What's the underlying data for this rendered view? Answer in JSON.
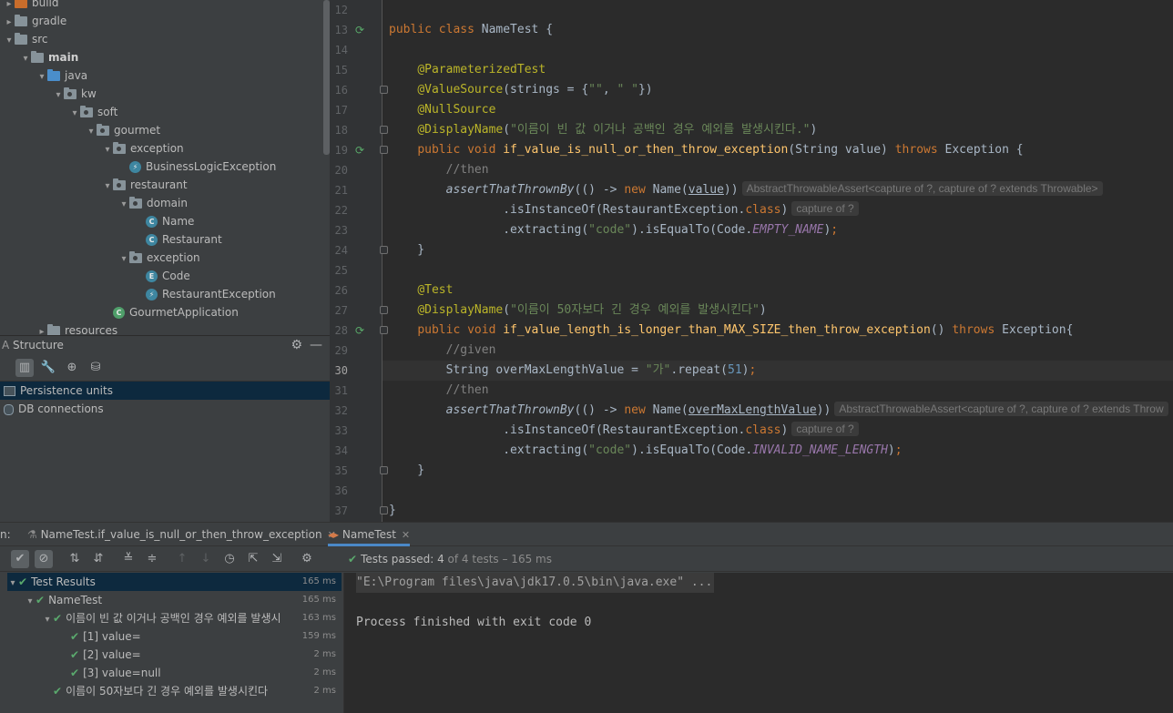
{
  "project_tree": [
    {
      "label": "build",
      "icon": "folder-orange",
      "indent": 0,
      "arrow": "▸"
    },
    {
      "label": "gradle",
      "icon": "folder",
      "indent": 0,
      "arrow": "▸"
    },
    {
      "label": "src",
      "icon": "folder",
      "indent": 0,
      "arrow": "▾"
    },
    {
      "label": "main",
      "icon": "folder",
      "indent": 1,
      "arrow": "▾",
      "bold": true
    },
    {
      "label": "java",
      "icon": "folder-blue",
      "indent": 2,
      "arrow": "▾"
    },
    {
      "label": "kw",
      "icon": "package",
      "indent": 3,
      "arrow": "▾"
    },
    {
      "label": "soft",
      "icon": "package",
      "indent": 4,
      "arrow": "▾"
    },
    {
      "label": "gourmet",
      "icon": "package",
      "indent": 5,
      "arrow": "▾"
    },
    {
      "label": "exception",
      "icon": "package",
      "indent": 6,
      "arrow": "▾"
    },
    {
      "label": "BusinessLogicException",
      "icon": "exception-class",
      "indent": 7,
      "arrow": ""
    },
    {
      "label": "restaurant",
      "icon": "package",
      "indent": 6,
      "arrow": "▾"
    },
    {
      "label": "domain",
      "icon": "package",
      "indent": 7,
      "arrow": "▾"
    },
    {
      "label": "Name",
      "icon": "class",
      "indent": 8,
      "arrow": ""
    },
    {
      "label": "Restaurant",
      "icon": "class",
      "indent": 8,
      "arrow": ""
    },
    {
      "label": "exception",
      "icon": "package",
      "indent": 7,
      "arrow": "▾"
    },
    {
      "label": "Code",
      "icon": "enum",
      "indent": 8,
      "arrow": ""
    },
    {
      "label": "RestaurantException",
      "icon": "exception-class",
      "indent": 8,
      "arrow": ""
    },
    {
      "label": "GourmetApplication",
      "icon": "spring-class",
      "indent": 6,
      "arrow": ""
    },
    {
      "label": "resources",
      "icon": "folder",
      "indent": 2,
      "arrow": "▸"
    }
  ],
  "structure": {
    "title": "Structure",
    "items": [
      "Persistence units",
      "DB connections"
    ]
  },
  "editor": {
    "lines": [
      {
        "n": "12",
        "html": ""
      },
      {
        "n": "13",
        "html": "<span class='kw'>public class </span>NameTest {",
        "run": true
      },
      {
        "n": "14",
        "html": ""
      },
      {
        "n": "15",
        "html": "    <span class='ann'>@ParameterizedTest</span>"
      },
      {
        "n": "16",
        "html": "    <span class='ann'>@ValueSource</span>(strings = {<span class='str'>\"\"</span>, <span class='str'>\" \"</span>})",
        "fold": true
      },
      {
        "n": "17",
        "html": "    <span class='ann'>@NullSource</span>"
      },
      {
        "n": "18",
        "html": "    <span class='ann'>@DisplayName</span>(<span class='str'>\"이름이 빈 값 이거나 공백인 경우 예외를 발생시킨다.\"</span>)",
        "fold": true
      },
      {
        "n": "19",
        "html": "    <span class='kw'>public void </span><span class='fn'>if_value_is_null_or_then_throw_exception</span>(String value) <span class='kw'>throws </span>Exception {",
        "run": true,
        "fold": true
      },
      {
        "n": "20",
        "html": "        <span class='cmt'>//then</span>"
      },
      {
        "n": "21",
        "html": "        <span class='italic'>assertThatThrownBy</span>(() -> <span class='kw'>new </span>Name(<span class='ul'>value</span>))<span class='hint'>AbstractThrowableAssert&lt;capture of ?, capture of ? extends Throwable&gt;</span>"
      },
      {
        "n": "22",
        "html": "                .isInstanceOf(RestaurantException.<span class='kw'>class</span>)<span class='hint'>capture of ?</span>"
      },
      {
        "n": "23",
        "html": "                .extracting(<span class='str'>\"code\"</span>).isEqualTo(Code.<span class='cst'>EMPTY_NAME</span>)<span class='kw'>;</span>"
      },
      {
        "n": "24",
        "html": "    }",
        "fold": true
      },
      {
        "n": "25",
        "html": ""
      },
      {
        "n": "26",
        "html": "    <span class='ann'>@Test</span>"
      },
      {
        "n": "27",
        "html": "    <span class='ann'>@DisplayName</span>(<span class='str'>\"이름이 50자보다 긴 경우 예외를 발생시킨다\"</span>)",
        "fold": true
      },
      {
        "n": "28",
        "html": "    <span class='kw'>public void </span><span class='fn'>if_value_length_is_longer_than_MAX_SIZE_then_throw_exception</span>() <span class='kw'>throws </span>Exception{",
        "run": true,
        "fold": true
      },
      {
        "n": "29",
        "html": "        <span class='cmt'>//given</span>"
      },
      {
        "n": "30",
        "html": "        String overMaxLengthValue = <span class='str'>\"가\"</span>.repeat(<span class='num'>51</span>)<span class='kw'>;</span>",
        "current": true
      },
      {
        "n": "31",
        "html": "        <span class='cmt'>//then</span>"
      },
      {
        "n": "32",
        "html": "        <span class='italic'>assertThatThrownBy</span>(() -> <span class='kw'>new </span>Name(<span class='ul'>overMaxLengthValue</span>))<span class='hint'>AbstractThrowableAssert&lt;capture of ?, capture of ? extends Throw</span>"
      },
      {
        "n": "33",
        "html": "                .isInstanceOf(RestaurantException.<span class='kw'>class</span>)<span class='hint'>capture of ?</span>"
      },
      {
        "n": "34",
        "html": "                .extracting(<span class='str'>\"code\"</span>).isEqualTo(Code.<span class='cst'>INVALID_NAME_LENGTH</span>)<span class='kw'>;</span>"
      },
      {
        "n": "35",
        "html": "    }",
        "fold": true
      },
      {
        "n": "36",
        "html": ""
      },
      {
        "n": "37",
        "html": "}",
        "fold": true
      }
    ]
  },
  "run_panel": {
    "label_prefix": "n:",
    "tabs": [
      {
        "label": "NameTest.if_value_is_null_or_then_throw_exception",
        "active": false
      },
      {
        "label": "NameTest",
        "active": true
      }
    ],
    "status": {
      "prefix": "Tests passed: ",
      "passed": "4",
      "suffix": " of 4 tests – 165 ms"
    },
    "results": [
      {
        "label": "Test Results",
        "time": "165 ms",
        "indent": 0,
        "arrow": "▾",
        "selected": true
      },
      {
        "label": "NameTest",
        "time": "165 ms",
        "indent": 1,
        "arrow": "▾"
      },
      {
        "label": "이름이 빈 값 이거나 공백인 경우 예외를 발생시",
        "time": "163 ms",
        "indent": 2,
        "arrow": "▾"
      },
      {
        "label": "[1] value=",
        "time": "159 ms",
        "indent": 3,
        "arrow": ""
      },
      {
        "label": "[2] value=",
        "time": "2 ms",
        "indent": 3,
        "arrow": ""
      },
      {
        "label": "[3] value=null",
        "time": "2 ms",
        "indent": 3,
        "arrow": ""
      },
      {
        "label": "이름이 50자보다 긴 경우 예외를 발생시킨다",
        "time": "2 ms",
        "indent": 2,
        "arrow": ""
      }
    ],
    "console": [
      "\"E:\\Program files\\java\\jdk17.0.5\\bin\\java.exe\" ...",
      "",
      "Process finished with exit code 0"
    ]
  }
}
